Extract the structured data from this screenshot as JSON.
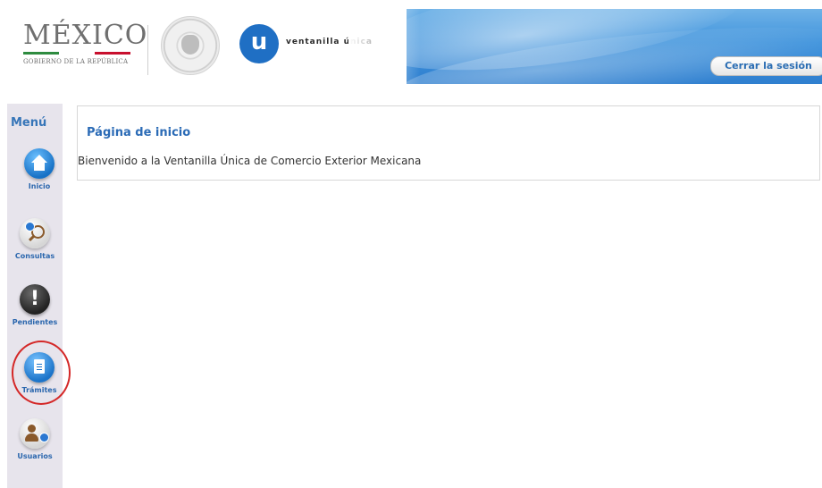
{
  "header": {
    "brand": {
      "title": "MÉXICO",
      "subtitle": "GOBIERNO DE LA REPÚBLICA"
    },
    "vu_logo_letter": "u",
    "vu_logo_text": "ventanilla única",
    "logout_label": "Cerrar la sesión",
    "seal_icon": "escudo-nacional",
    "band_color": "#3f93dc"
  },
  "sidebar": {
    "title": "Menú",
    "items": [
      {
        "label": "Inicio",
        "icon": "home-icon"
      },
      {
        "label": "Consultas",
        "icon": "search-icon"
      },
      {
        "label": "Pendientes",
        "icon": "alert-icon",
        "glyph": "!"
      },
      {
        "label": "Trámites",
        "icon": "document-icon"
      },
      {
        "label": "Usuarios",
        "icon": "users-icon"
      }
    ],
    "highlight_color": "#d42828"
  },
  "main": {
    "panel_title": "Página de inicio",
    "welcome_text": "Bienvenido a la Ventanilla Única de Comercio Exterior Mexicana"
  },
  "colors": {
    "accent": "#2b6bb6",
    "sidebar_bg": "#e7e4ec"
  }
}
